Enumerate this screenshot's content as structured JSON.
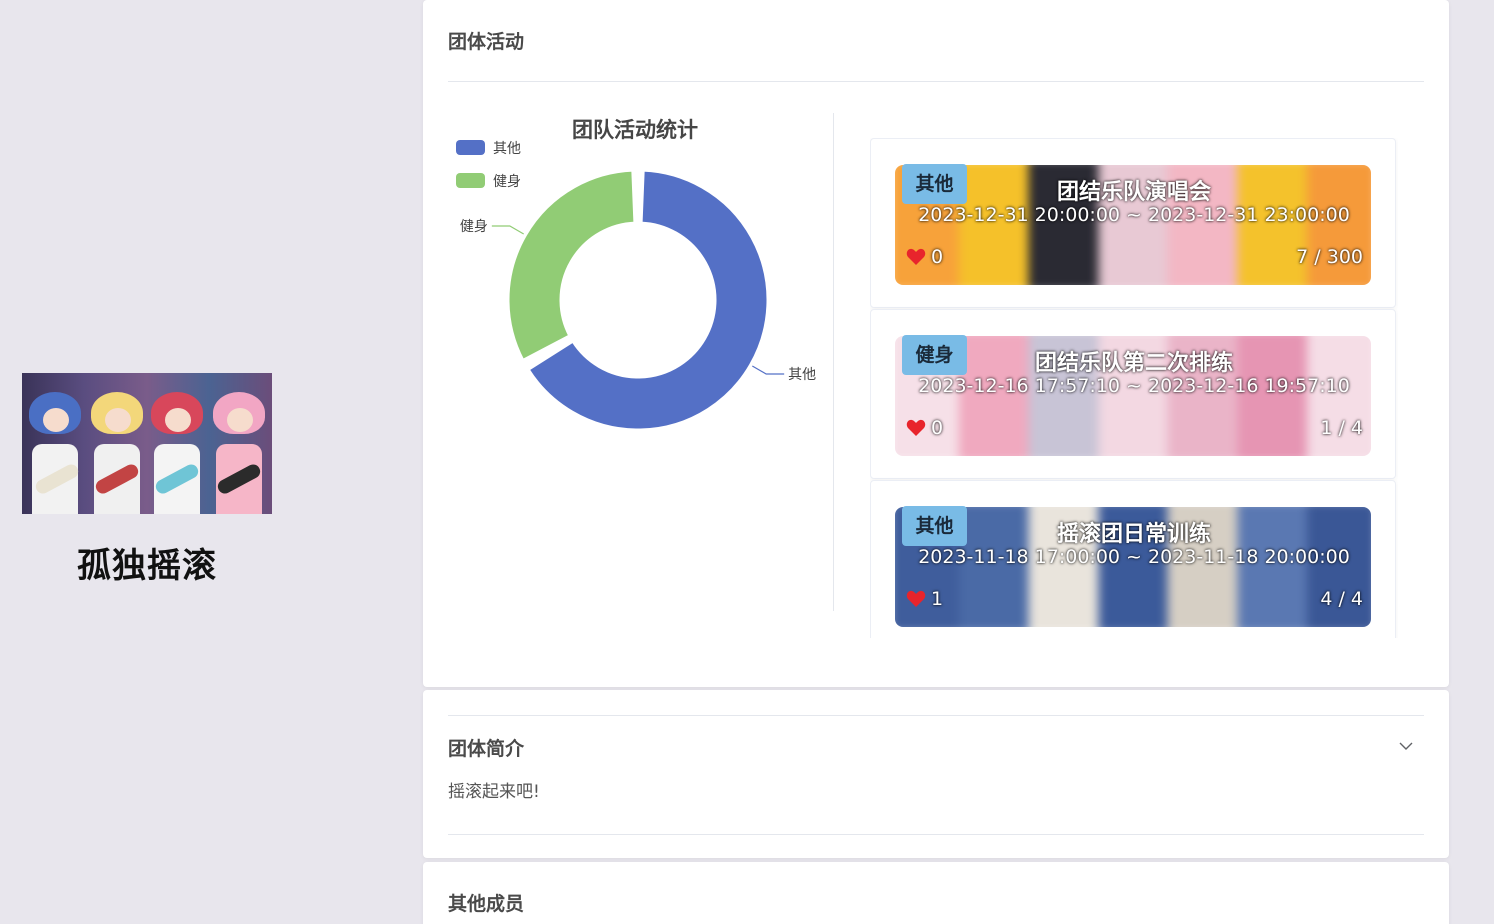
{
  "profile": {
    "group_name": "孤独摇滚"
  },
  "activities_section": {
    "title": "团体活动",
    "chart_data": {
      "type": "pie",
      "title": "团队活动统计",
      "legend": [
        "其他",
        "健身"
      ],
      "legend_position": "top-left",
      "labels": [
        "其他",
        "健身"
      ],
      "values": [
        2,
        1
      ],
      "colors": [
        "#5470c6",
        "#91cc75"
      ],
      "donut": true
    },
    "items": [
      {
        "tag": "其他",
        "title": "团结乐队演唱会",
        "time": "2023-12-31 20:00:00 ~ 2023-12-31 23:00:00",
        "likes": "0",
        "count": "7 / 300",
        "banner_colors": [
          "#f7a23a",
          "#f5c12a",
          "#2a2a33",
          "#e8c9d4",
          "#f3b7c4",
          "#f4c22c",
          "#f59a3a"
        ]
      },
      {
        "tag": "健身",
        "title": "团结乐队第二次排练",
        "time": "2023-12-16 17:57:10 ~ 2023-12-16 19:57:10",
        "likes": "0",
        "count": "1 / 4",
        "banner_colors": [
          "#f6e0e8",
          "#f0a9bf",
          "#c8c4d6",
          "#f3d8e2",
          "#eab4c8",
          "#e695b3",
          "#f5dde6"
        ]
      },
      {
        "tag": "其他",
        "title": "摇滚团日常训练",
        "time": "2023-11-18 17:00:00 ~ 2023-11-18 20:00:00",
        "likes": "1",
        "count": "4 / 4",
        "banner_colors": [
          "#3f5d9c",
          "#4a6aa6",
          "#e9e4dc",
          "#3b5a9a",
          "#d6cfc4",
          "#5a78b2",
          "#3a5796"
        ]
      }
    ]
  },
  "intro_section": {
    "title": "团体简介",
    "text": "摇滚起来吧!"
  },
  "members_section": {
    "title": "其他成员"
  }
}
